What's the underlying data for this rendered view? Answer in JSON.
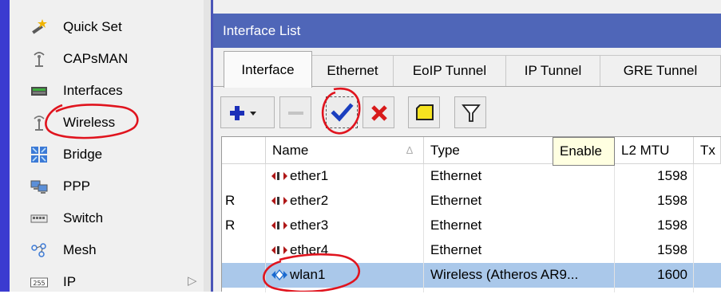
{
  "nav": {
    "items": [
      {
        "label": "Quick Set",
        "icon": "magic-wand-icon"
      },
      {
        "label": "CAPsMAN",
        "icon": "antenna-icon"
      },
      {
        "label": "Interfaces",
        "icon": "network-card-icon"
      },
      {
        "label": "Wireless",
        "icon": "wireless-antenna-icon"
      },
      {
        "label": "Bridge",
        "icon": "bridge-icon"
      },
      {
        "label": "PPP",
        "icon": "ppp-computers-icon"
      },
      {
        "label": "Switch",
        "icon": "switch-icon"
      },
      {
        "label": "Mesh",
        "icon": "mesh-icon"
      },
      {
        "label": "IP",
        "icon": "ip-icon",
        "badge": "255"
      }
    ],
    "submenu_arrow": "▷"
  },
  "window": {
    "title": "Interface List",
    "tabs": [
      {
        "label": "Interface",
        "active": true
      },
      {
        "label": "Ethernet"
      },
      {
        "label": "EoIP Tunnel"
      },
      {
        "label": "IP Tunnel"
      },
      {
        "label": "GRE Tunnel"
      }
    ],
    "toolbar": [
      {
        "name": "add-button",
        "icon": "plus-icon"
      },
      {
        "name": "remove-button",
        "icon": "minus-icon"
      },
      {
        "name": "enable-button",
        "icon": "checkmark-icon"
      },
      {
        "name": "disable-button",
        "icon": "red-x-icon"
      },
      {
        "name": "comment-button",
        "icon": "note-icon"
      },
      {
        "name": "filter-button",
        "icon": "funnel-icon"
      }
    ],
    "tooltip": "Enable"
  },
  "table": {
    "columns": [
      "",
      "Name",
      "Type",
      "L2 MTU",
      "Tx"
    ],
    "sort_marker": "∆",
    "rows": [
      {
        "flag": "",
        "name": "ether1",
        "type": "Ethernet",
        "l2mtu": "1598",
        "icon": "ethernet-icon",
        "selected": false
      },
      {
        "flag": "R",
        "name": "ether2",
        "type": "Ethernet",
        "l2mtu": "1598",
        "icon": "ethernet-icon",
        "selected": false
      },
      {
        "flag": "R",
        "name": "ether3",
        "type": "Ethernet",
        "l2mtu": "1598",
        "icon": "ethernet-icon",
        "selected": false
      },
      {
        "flag": "",
        "name": "ether4",
        "type": "Ethernet",
        "l2mtu": "1598",
        "icon": "ethernet-icon",
        "selected": false
      },
      {
        "flag": "",
        "name": "wlan1",
        "type": "Wireless (Atheros AR9...",
        "l2mtu": "1600",
        "icon": "wireless-interface-icon",
        "selected": true
      }
    ]
  },
  "colors": {
    "nav_strip": "#3b3bd0",
    "titlebar": "#4f66b8",
    "selected_row": "#aac8ea",
    "annotation": "#e0141e",
    "tooltip_bg": "#ffffe1"
  }
}
